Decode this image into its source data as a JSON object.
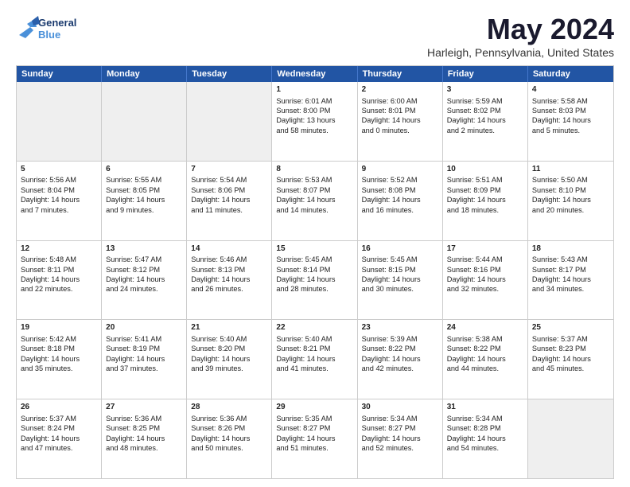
{
  "header": {
    "logo_general": "General",
    "logo_blue": "Blue",
    "month": "May 2024",
    "location": "Harleigh, Pennsylvania, United States"
  },
  "days": [
    "Sunday",
    "Monday",
    "Tuesday",
    "Wednesday",
    "Thursday",
    "Friday",
    "Saturday"
  ],
  "rows": [
    [
      {
        "day": "",
        "info": "",
        "shaded": true
      },
      {
        "day": "",
        "info": "",
        "shaded": true
      },
      {
        "day": "",
        "info": "",
        "shaded": true
      },
      {
        "day": "1",
        "info": "Sunrise: 6:01 AM\nSunset: 8:00 PM\nDaylight: 13 hours\nand 58 minutes.",
        "shaded": false
      },
      {
        "day": "2",
        "info": "Sunrise: 6:00 AM\nSunset: 8:01 PM\nDaylight: 14 hours\nand 0 minutes.",
        "shaded": false
      },
      {
        "day": "3",
        "info": "Sunrise: 5:59 AM\nSunset: 8:02 PM\nDaylight: 14 hours\nand 2 minutes.",
        "shaded": false
      },
      {
        "day": "4",
        "info": "Sunrise: 5:58 AM\nSunset: 8:03 PM\nDaylight: 14 hours\nand 5 minutes.",
        "shaded": false
      }
    ],
    [
      {
        "day": "5",
        "info": "Sunrise: 5:56 AM\nSunset: 8:04 PM\nDaylight: 14 hours\nand 7 minutes.",
        "shaded": false
      },
      {
        "day": "6",
        "info": "Sunrise: 5:55 AM\nSunset: 8:05 PM\nDaylight: 14 hours\nand 9 minutes.",
        "shaded": false
      },
      {
        "day": "7",
        "info": "Sunrise: 5:54 AM\nSunset: 8:06 PM\nDaylight: 14 hours\nand 11 minutes.",
        "shaded": false
      },
      {
        "day": "8",
        "info": "Sunrise: 5:53 AM\nSunset: 8:07 PM\nDaylight: 14 hours\nand 14 minutes.",
        "shaded": false
      },
      {
        "day": "9",
        "info": "Sunrise: 5:52 AM\nSunset: 8:08 PM\nDaylight: 14 hours\nand 16 minutes.",
        "shaded": false
      },
      {
        "day": "10",
        "info": "Sunrise: 5:51 AM\nSunset: 8:09 PM\nDaylight: 14 hours\nand 18 minutes.",
        "shaded": false
      },
      {
        "day": "11",
        "info": "Sunrise: 5:50 AM\nSunset: 8:10 PM\nDaylight: 14 hours\nand 20 minutes.",
        "shaded": false
      }
    ],
    [
      {
        "day": "12",
        "info": "Sunrise: 5:48 AM\nSunset: 8:11 PM\nDaylight: 14 hours\nand 22 minutes.",
        "shaded": false
      },
      {
        "day": "13",
        "info": "Sunrise: 5:47 AM\nSunset: 8:12 PM\nDaylight: 14 hours\nand 24 minutes.",
        "shaded": false
      },
      {
        "day": "14",
        "info": "Sunrise: 5:46 AM\nSunset: 8:13 PM\nDaylight: 14 hours\nand 26 minutes.",
        "shaded": false
      },
      {
        "day": "15",
        "info": "Sunrise: 5:45 AM\nSunset: 8:14 PM\nDaylight: 14 hours\nand 28 minutes.",
        "shaded": false
      },
      {
        "day": "16",
        "info": "Sunrise: 5:45 AM\nSunset: 8:15 PM\nDaylight: 14 hours\nand 30 minutes.",
        "shaded": false
      },
      {
        "day": "17",
        "info": "Sunrise: 5:44 AM\nSunset: 8:16 PM\nDaylight: 14 hours\nand 32 minutes.",
        "shaded": false
      },
      {
        "day": "18",
        "info": "Sunrise: 5:43 AM\nSunset: 8:17 PM\nDaylight: 14 hours\nand 34 minutes.",
        "shaded": false
      }
    ],
    [
      {
        "day": "19",
        "info": "Sunrise: 5:42 AM\nSunset: 8:18 PM\nDaylight: 14 hours\nand 35 minutes.",
        "shaded": false
      },
      {
        "day": "20",
        "info": "Sunrise: 5:41 AM\nSunset: 8:19 PM\nDaylight: 14 hours\nand 37 minutes.",
        "shaded": false
      },
      {
        "day": "21",
        "info": "Sunrise: 5:40 AM\nSunset: 8:20 PM\nDaylight: 14 hours\nand 39 minutes.",
        "shaded": false
      },
      {
        "day": "22",
        "info": "Sunrise: 5:40 AM\nSunset: 8:21 PM\nDaylight: 14 hours\nand 41 minutes.",
        "shaded": false
      },
      {
        "day": "23",
        "info": "Sunrise: 5:39 AM\nSunset: 8:22 PM\nDaylight: 14 hours\nand 42 minutes.",
        "shaded": false
      },
      {
        "day": "24",
        "info": "Sunrise: 5:38 AM\nSunset: 8:22 PM\nDaylight: 14 hours\nand 44 minutes.",
        "shaded": false
      },
      {
        "day": "25",
        "info": "Sunrise: 5:37 AM\nSunset: 8:23 PM\nDaylight: 14 hours\nand 45 minutes.",
        "shaded": false
      }
    ],
    [
      {
        "day": "26",
        "info": "Sunrise: 5:37 AM\nSunset: 8:24 PM\nDaylight: 14 hours\nand 47 minutes.",
        "shaded": false
      },
      {
        "day": "27",
        "info": "Sunrise: 5:36 AM\nSunset: 8:25 PM\nDaylight: 14 hours\nand 48 minutes.",
        "shaded": false
      },
      {
        "day": "28",
        "info": "Sunrise: 5:36 AM\nSunset: 8:26 PM\nDaylight: 14 hours\nand 50 minutes.",
        "shaded": false
      },
      {
        "day": "29",
        "info": "Sunrise: 5:35 AM\nSunset: 8:27 PM\nDaylight: 14 hours\nand 51 minutes.",
        "shaded": false
      },
      {
        "day": "30",
        "info": "Sunrise: 5:34 AM\nSunset: 8:27 PM\nDaylight: 14 hours\nand 52 minutes.",
        "shaded": false
      },
      {
        "day": "31",
        "info": "Sunrise: 5:34 AM\nSunset: 8:28 PM\nDaylight: 14 hours\nand 54 minutes.",
        "shaded": false
      },
      {
        "day": "",
        "info": "",
        "shaded": true
      }
    ]
  ]
}
